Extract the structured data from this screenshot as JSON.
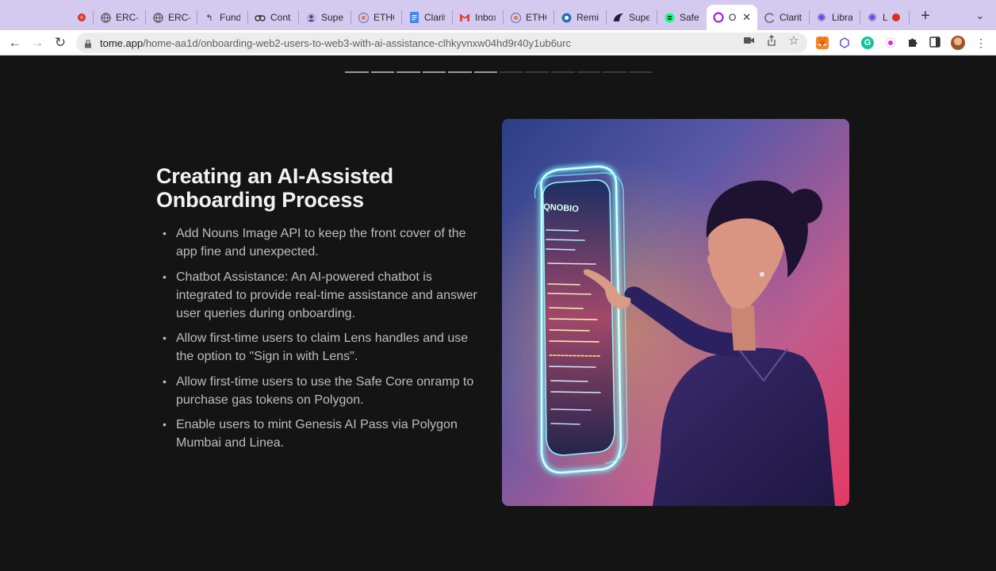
{
  "browser": {
    "tabs": [
      {
        "label": "",
        "icon": "record-icon"
      },
      {
        "label": "ERC-(",
        "icon": "globe-icon"
      },
      {
        "label": "ERC-",
        "icon": "globe-icon"
      },
      {
        "label": "Fund",
        "icon": "gitcoin-icon"
      },
      {
        "label": "Contr",
        "icon": "binoculars-icon"
      },
      {
        "label": "Super",
        "icon": "superfluid-icon"
      },
      {
        "label": "ETHG",
        "icon": "ethglobal-icon"
      },
      {
        "label": "Clarit",
        "icon": "docs-icon"
      },
      {
        "label": "Inbox",
        "icon": "gmail-icon"
      },
      {
        "label": "ETHG",
        "icon": "ethglobal-icon"
      },
      {
        "label": "Remi",
        "icon": "remix-icon"
      },
      {
        "label": "Super",
        "icon": "superfluid-icon"
      },
      {
        "label": "Safe",
        "icon": "safe-icon"
      },
      {
        "label": "O",
        "icon": "tome-icon"
      },
      {
        "label": "Clarit",
        "icon": "loading-icon"
      },
      {
        "label": "Librar",
        "icon": "gear-icon"
      },
      {
        "label": "Li",
        "icon": "gear-icon"
      }
    ],
    "active_tab_index": 13,
    "url_host": "tome.app",
    "url_path": "/home-aa1d/onboarding-web2-users-to-web3-with-ai-assistance-clhkyvnxw04hd9r40y1ub6urc"
  },
  "slide": {
    "progress_total": 12,
    "progress_done": 6,
    "title": "Creating an AI-Assisted Onboarding Process",
    "bullets": [
      "Add Nouns Image API to keep the front cover of the app fine and unexpected.",
      "Chatbot Assistance: An AI-powered chatbot is integrated to provide real-time assistance and answer user queries during onboarding.",
      "Allow first-time users to claim Lens handles and use the option to \"Sign in with Lens\".",
      "Allow first-time users to use the Safe Core onramp to purchase gas tokens on Polygon.",
      "Enable users to mint Genesis AI Pass via Polygon Mumbai and Linea."
    ],
    "screen_heading": "QNOBIO"
  },
  "colors": {
    "tabstrip": "#d4c9ef",
    "page_bg": "#141414",
    "title": "#f2f2f2",
    "body_text": "#bdbdbd",
    "accent_glow": "#6ff5ff"
  }
}
